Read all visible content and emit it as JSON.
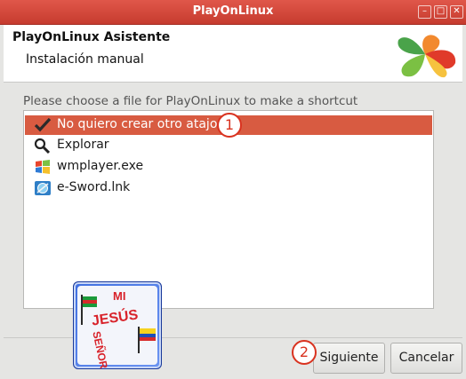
{
  "window": {
    "title": "PlayOnLinux"
  },
  "header": {
    "title": "PlayOnLinux Asistente",
    "subtitle": "Instalación manual"
  },
  "prompt": "Please choose a file for PlayOnLinux to make a shortcut",
  "list": {
    "items": [
      {
        "label": "No quiero crear otro atajo",
        "icon": "checkmark-icon",
        "selected": true
      },
      {
        "label": "Explorar",
        "icon": "magnifier-icon",
        "selected": false
      },
      {
        "label": "wmplayer.exe",
        "icon": "windows-media-player-icon",
        "selected": false
      },
      {
        "label": "e-Sword.lnk",
        "icon": "esword-icon",
        "selected": false
      }
    ]
  },
  "annotations": [
    "1",
    "2"
  ],
  "buttons": {
    "next": "Siguiente",
    "cancel": "Cancelar"
  },
  "stamp": {
    "lines": [
      "MI",
      "JESÚS",
      "SEÑOR"
    ]
  },
  "colors": {
    "titlebar": "#d24a3d",
    "selection": "#d85b41",
    "annotation": "#d9321f"
  }
}
